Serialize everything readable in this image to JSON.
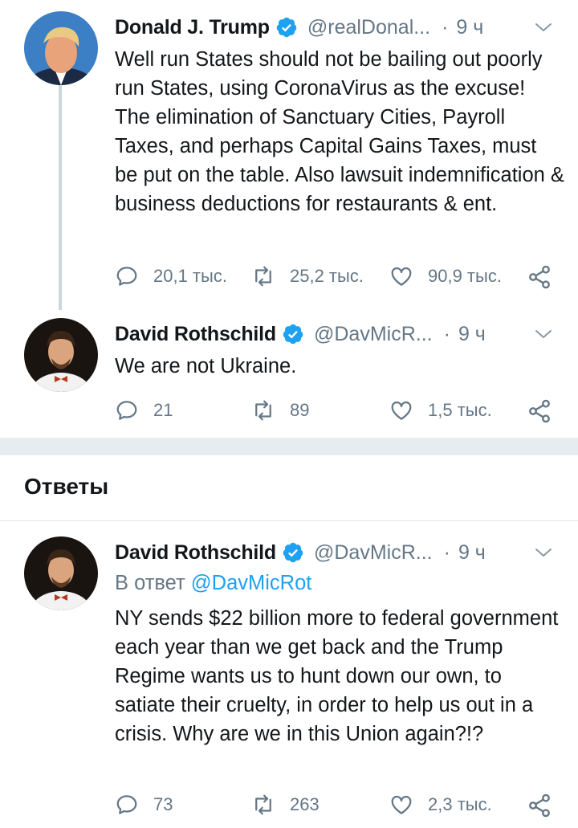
{
  "tweets": [
    {
      "name": "Donald J. Trump",
      "handle": "@realDonal...",
      "dot": "·",
      "time": "9 ч",
      "text": "Well run States should not be bailing out poorly run States, using CoronaVirus as the excuse! The elimination of Sanctuary Cities, Payroll Taxes, and perhaps Capital Gains Taxes, must be put on the table. Also lawsuit indemnification & business deductions for restaurants & ent.",
      "replies": "20,1 тыс.",
      "retweets": "25,2 тыс.",
      "likes": "90,9 тыс."
    },
    {
      "name": "David Rothschild",
      "handle": "@DavMicR...",
      "dot": "·",
      "time": "9 ч",
      "text": "We are not Ukraine.",
      "replies": "21",
      "retweets": "89",
      "likes": "1,5 тыс."
    }
  ],
  "replies_section": {
    "title": "Ответы"
  },
  "reply_tweet": {
    "name": "David Rothschild",
    "handle": "@DavMicR...",
    "dot": "·",
    "time": "9 ч",
    "reply_prefix": "В ответ",
    "reply_mention": "@DavMicRot",
    "text": "NY sends $22 billion more to federal government each year than we get back and the Trump Regime wants us to hunt down our own, to satiate their cruelty, in order to help us out in a crisis. Why are we in this Union again?!?",
    "replies": "73",
    "retweets": "263",
    "likes": "2,3 тыс."
  },
  "colors": {
    "verified": "#1da1f2",
    "text_secondary": "#657786",
    "link": "#1da1f2",
    "thread_line": "#ccd6dd",
    "separator": "#e6ecf0"
  }
}
